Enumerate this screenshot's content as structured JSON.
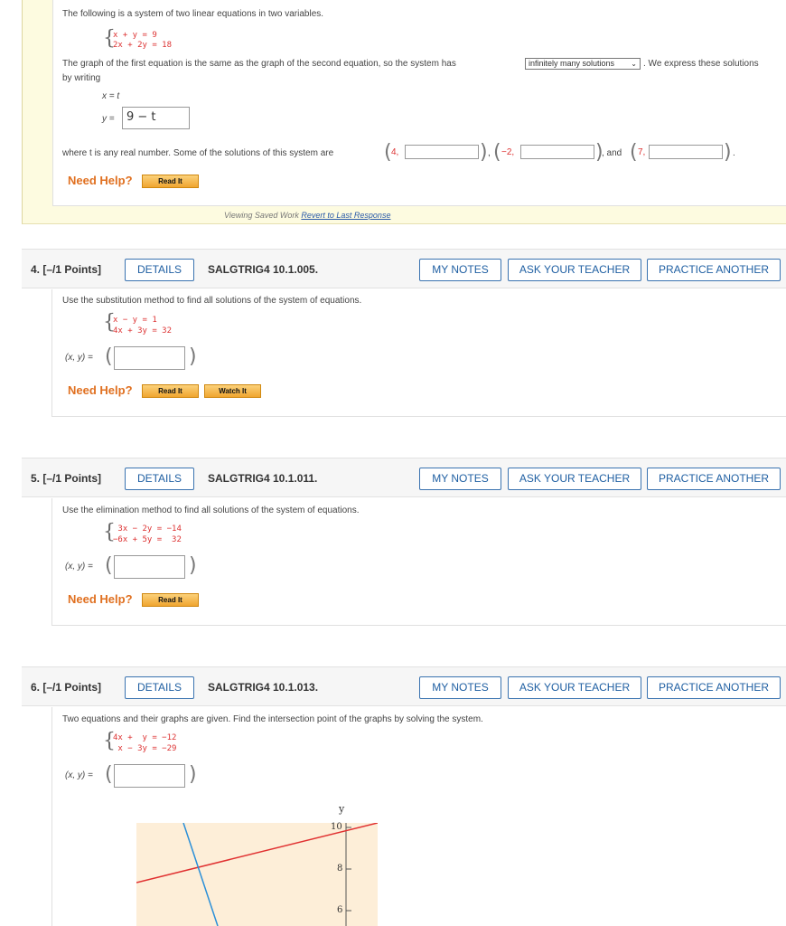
{
  "q3": {
    "intro": "The following is a system of two linear equations in two variables.",
    "eq1": "x +  y = 9",
    "eq2": "2x + 2y = 18",
    "graph_text_before": "The graph of the first equation is the same as the graph of the second equation, so the system has",
    "dropdown_value": "infinitely many solutions",
    "graph_text_after": ". We express these solutions",
    "graph_text_line2": "by writing",
    "x_eq": "x = t",
    "y_label": "y =",
    "y_value": "9 − t",
    "where_text": "where t is any real number. Some of the solutions of this system are",
    "sol1_x": "4,",
    "sol2_x": "−2,",
    "and_text": ", and",
    "sol3_x": "7,",
    "need_help": "Need Help?",
    "read_it": "Read It",
    "viewing": "Viewing Saved Work",
    "revert": "Revert to Last Response"
  },
  "questions": [
    {
      "number": "4. [–/1 Points]",
      "details": "DETAILS",
      "code": "SALGTRIG4 10.1.005.",
      "my_notes": "MY NOTES",
      "ask": "ASK YOUR TEACHER",
      "practice": "PRACTICE ANOTHER",
      "prompt": "Use the substitution method to find all solutions of the system of equations.",
      "eq1": "x −  y = 1",
      "eq2": "4x + 3y = 32",
      "answer_label": "(x, y) =",
      "need_help": "Need Help?",
      "read_it": "Read It",
      "watch_it": "Watch It"
    },
    {
      "number": "5. [–/1 Points]",
      "details": "DETAILS",
      "code": "SALGTRIG4 10.1.011.",
      "my_notes": "MY NOTES",
      "ask": "ASK YOUR TEACHER",
      "practice": "PRACTICE ANOTHER",
      "prompt": "Use the elimination method to find all solutions of the system of equations.",
      "eq1": " 3x − 2y = −14",
      "eq2": "−6x + 5y =  32",
      "answer_label": "(x, y) =",
      "need_help": "Need Help?",
      "read_it": "Read It"
    },
    {
      "number": "6. [–/1 Points]",
      "details": "DETAILS",
      "code": "SALGTRIG4 10.1.013.",
      "my_notes": "MY NOTES",
      "ask": "ASK YOUR TEACHER",
      "practice": "PRACTICE ANOTHER",
      "prompt": "Two equations and their graphs are given. Find the intersection point of the graphs by solving the system.",
      "eq1": "4x +  y = −12",
      "eq2": " x − 3y = −29",
      "answer_label": "(x, y) =",
      "graph": {
        "y_axis_label": "y",
        "ticks": [
          "10",
          "8",
          "6"
        ],
        "line1_color": "#e03030",
        "line2_color": "#2a8fd8",
        "bg_color": "#fdeed8"
      }
    }
  ]
}
